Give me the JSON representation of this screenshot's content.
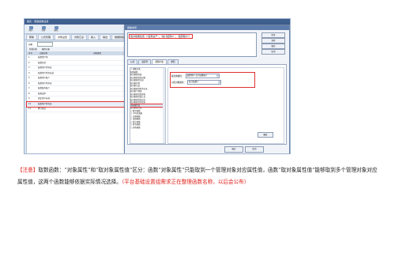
{
  "app": {
    "title": "报表 – 取数函数设置",
    "toolbar": [
      "保存",
      "打开",
      "刷新"
    ],
    "tabs": [
      "帮助",
      "公式管理",
      "对象设置",
      "对象汇总",
      "输入",
      "输出",
      "数据模板设置",
      "维护"
    ],
    "active_tab": 2
  },
  "left_panel": {
    "filter_label": "对象：",
    "filter_value": "",
    "actions": [
      "新增对象",
      "删除对象"
    ],
    "columns": [
      "序号",
      "对象名称",
      "对象属性"
    ],
    "rows": [
      {
        "no": "1",
        "name": "结算资产项",
        "attr": ""
      },
      {
        "no": "2",
        "name": "结算负债",
        "attr": ""
      },
      {
        "no": "3",
        "name": "结算资产所有权",
        "attr": ""
      },
      {
        "no": "4",
        "name": "结算资产所有权益",
        "attr": ""
      },
      {
        "no": "5",
        "name": "结算资产账户",
        "attr": ""
      },
      {
        "no": "6",
        "name": "结算资产所有权",
        "attr": ""
      },
      {
        "no": "7",
        "name": "结算服务账户",
        "attr": ""
      },
      {
        "no": "8",
        "name": "结算成本",
        "attr": ""
      },
      {
        "no": "9",
        "name": "固定资产标准",
        "attr": ""
      },
      {
        "no": "10",
        "name": "结算资产所有权",
        "attr": ""
      },
      {
        "no": "11",
        "name": "累计折旧",
        "attr": ""
      }
    ],
    "selected_row": 9
  },
  "dialog": {
    "title": "函数向导",
    "expression": "取对象属性值（\"结算资产\"，\"统计结算户\"，\"结算账户\"）",
    "side_buttons": [
      "检查",
      "清除",
      "确定",
      "取消"
    ],
    "tabs": [
      "公式",
      "运算符",
      "函数列表",
      "参照"
    ],
    "active_tab": 2,
    "tree": [
      "□ 函数分类",
      "  取数函数",
      "  取对象属性值",
      "  取对象属性值对象",
      "  取对象属性记录",
      "  取对象名称",
      "  取对象记录",
      "  取对象属性所有记录",
      "  取对象子项值",
      "  取对象属性值求和",
      "  取对象属性值汇总",
      "  取对象属性值对应",
      "  取对象属性的实际",
      "  对象属性值",
      "  取对象属性值",
      "□ 数学函数",
      "□ 字符串函数",
      "□ 日期函数",
      "□ 逻辑函数",
      "□ 统计函数",
      "□ 财务函数",
      "□ 其他函数"
    ],
    "tree_selected": 13,
    "params": [
      {
        "label": "取对象属性：",
        "value": "结算资产 总计结算账户"
      },
      {
        "label": "对应对象属性：",
        "value": "统计结算户"
      }
    ],
    "param_button": "确定",
    "footer_buttons": [
      "确定",
      "取消"
    ]
  },
  "caption": {
    "tag": "【注意】",
    "body": "取数函数：“对象属性”和“取对象属性值”区分：函数“对象属性”只能取到一个管理对象对应属性值，函数“取对象属性值”能够取到多个管理对象对应属性值，这两个函数能够依据实际情况选择。",
    "note": "（平台基础设置组需求正在整理函数名称，以后会公布）"
  }
}
